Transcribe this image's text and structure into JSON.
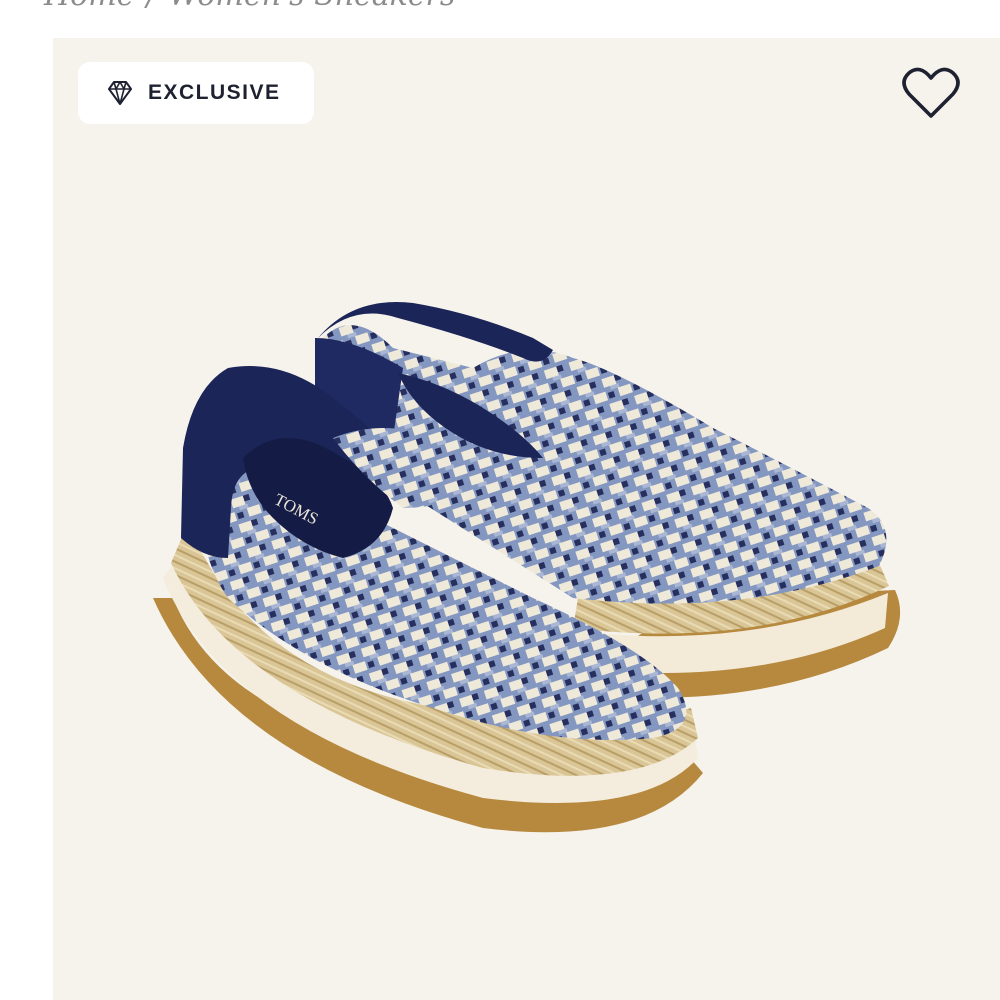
{
  "breadcrumb": {
    "home": "Home",
    "separator": "/",
    "current": "Women's Sneakers"
  },
  "product": {
    "badge_label": "EXCLUSIVE",
    "badge_icon": "diamond-icon",
    "wishlist_icon": "heart-outline-icon",
    "brand_mark": "TOMS"
  },
  "colors": {
    "image_bg": "#f6f3ec",
    "navy": "#1b2558",
    "chambray": "#7f93bd",
    "cream": "#efe9da",
    "jute": "#d6c08f",
    "gum": "#b6893f"
  }
}
